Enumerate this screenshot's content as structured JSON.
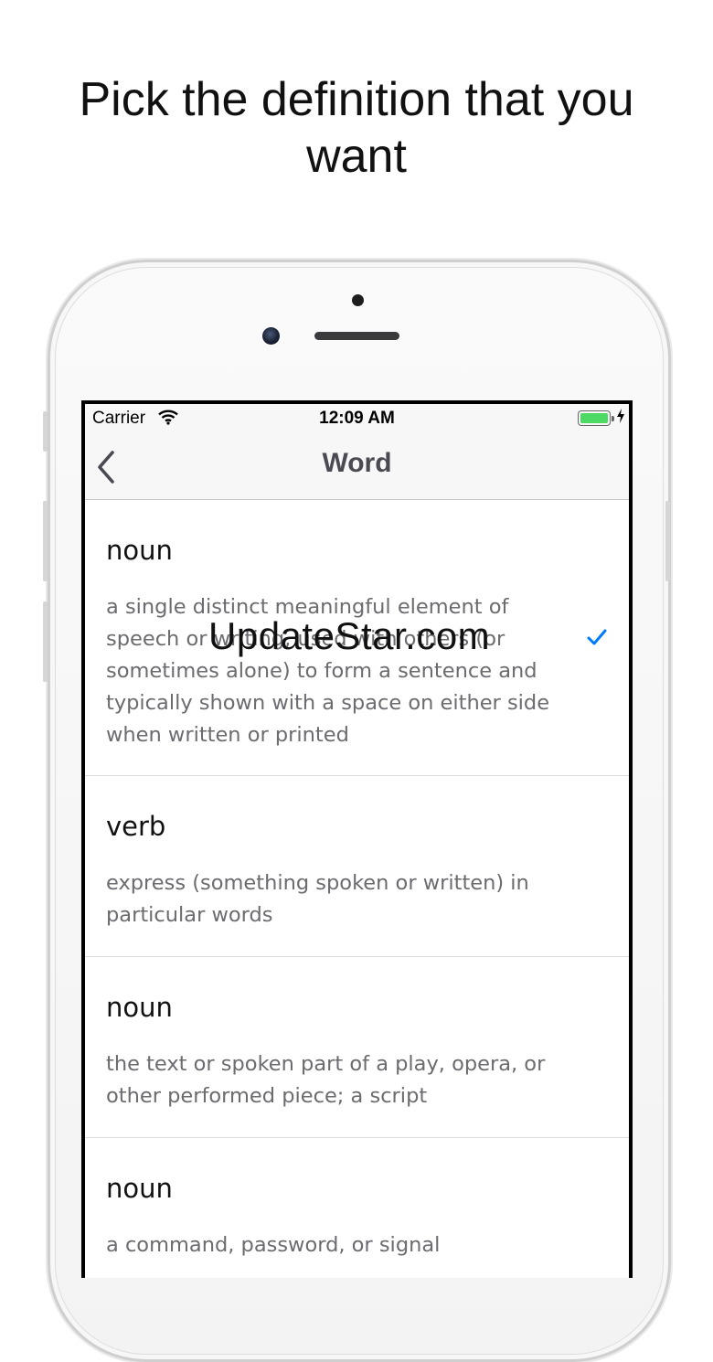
{
  "headline": "Pick the definition that you want",
  "status_bar": {
    "carrier": "Carrier",
    "time": "12:09 AM",
    "battery_level": 1.0
  },
  "nav": {
    "title": "Word",
    "back_icon": "chevron-left-icon"
  },
  "definitions": [
    {
      "pos": "noun",
      "text": "a single distinct meaningful element of speech or writing, used with others (or sometimes alone) to form a sentence and typically shown with a space on either side when written or printed",
      "selected": true
    },
    {
      "pos": "verb",
      "text": "express (something spoken or written) in particular words",
      "selected": false
    },
    {
      "pos": "noun",
      "text": "the text or spoken part of a play, opera, or other performed piece; a script",
      "selected": false
    },
    {
      "pos": "noun",
      "text": "a command, password, or signal",
      "selected": false
    }
  ],
  "watermark": "UpdateStar.com",
  "colors": {
    "accent": "#007aff",
    "battery": "#4cd964"
  }
}
